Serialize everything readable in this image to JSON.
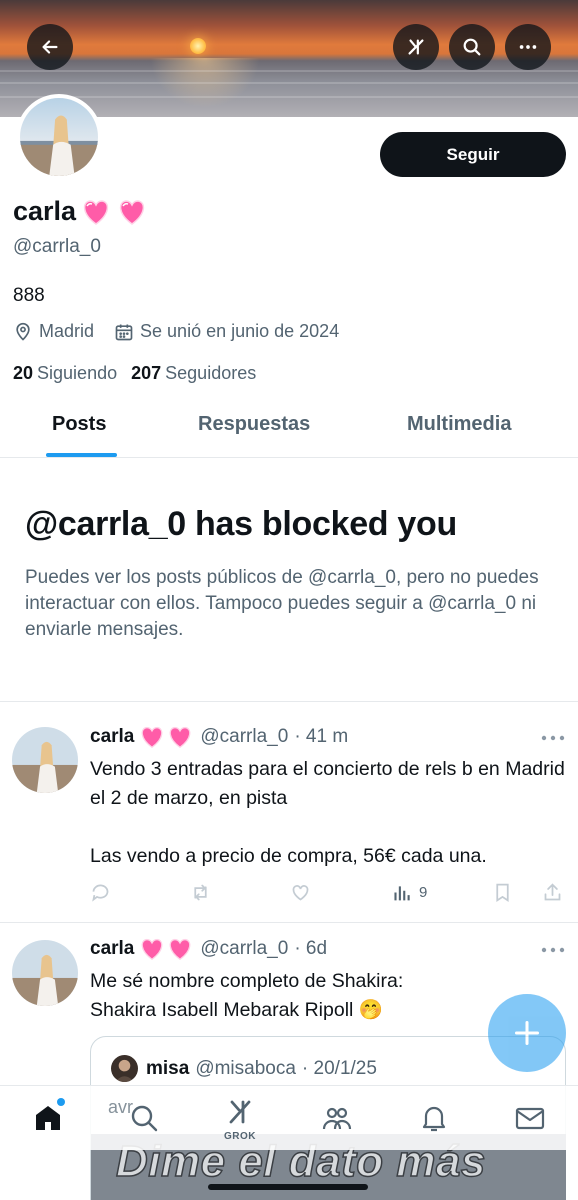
{
  "header": {
    "back_icon": "arrow-left-icon",
    "grok_icon": "grok-icon",
    "search_icon": "search-icon",
    "more_icon": "more-horizontal-icon"
  },
  "profile": {
    "follow_label": "Seguir",
    "name": "carla",
    "name_emoji": "pink-heart-emoji",
    "handle": "@carrla_0",
    "bio": "888",
    "location": "Madrid",
    "joined": "Se unió en junio de 2024",
    "following_count": "20",
    "following_label": "Siguiendo",
    "followers_count": "207",
    "followers_label": "Seguidores"
  },
  "tabs": [
    {
      "label": "Posts",
      "active": true
    },
    {
      "label": "Respuestas",
      "active": false
    },
    {
      "label": "Multimedia",
      "active": false
    }
  ],
  "blocked": {
    "title": "@carrla_0 has blocked you",
    "message": "Puedes ver los posts públicos de @carrla_0, pero no puedes interactuar con ellos. Tampoco puedes seguir a @carrla_0 ni enviarle mensajes."
  },
  "posts": [
    {
      "name": "carla",
      "handle": "@carrla_0",
      "time": "· 41 m",
      "text": "Vendo 3 entradas para el concierto de rels b en Madrid el 2 de marzo, en pista\n\nLas vendo a precio de compra, 56€ cada una.",
      "views": "9"
    },
    {
      "name": "carla",
      "handle": "@carrla_0",
      "time": "· 6d",
      "text": "Me sé nombre completo de Shakira:\nShakira Isabell Mebarak Ripoll 🤭",
      "quote": {
        "name": "misa",
        "handle": "@misaboca",
        "time": "· 20/1/25",
        "ghost_text": "avr",
        "caption": "Dime el dato más"
      }
    }
  ],
  "bottom_nav": {
    "items": [
      "home-icon",
      "search-icon",
      "grok-icon",
      "communities-icon",
      "notifications-icon",
      "messages-icon"
    ],
    "grok_label": "GROK"
  },
  "colors": {
    "accent": "#1d9bf0",
    "text": "#0f1419",
    "secondary": "#536471",
    "heart": "#ff5ca8"
  }
}
